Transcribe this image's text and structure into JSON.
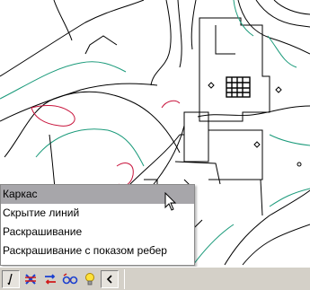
{
  "viewport": {
    "colors": {
      "contour_black": "#000000",
      "contour_green": "#1a9a7a",
      "contour_red": "#c8143c"
    }
  },
  "shade_menu": {
    "items": [
      {
        "label": "Каркас",
        "highlighted": true
      },
      {
        "label": "Скрытие линий",
        "highlighted": false
      },
      {
        "label": "Раскрашивание",
        "highlighted": false
      },
      {
        "label": "Раскрашивание с показом ребер",
        "highlighted": false
      }
    ]
  },
  "toolbar": {
    "buttons": [
      {
        "icon": "wireframe-shade-icon"
      },
      {
        "icon": "hidden-lines-icon"
      },
      {
        "icon": "shaded-icon"
      },
      {
        "icon": "shaded-edges-icon"
      },
      {
        "icon": "lightbulb-icon"
      },
      {
        "icon": "scroll-left-icon"
      }
    ]
  }
}
